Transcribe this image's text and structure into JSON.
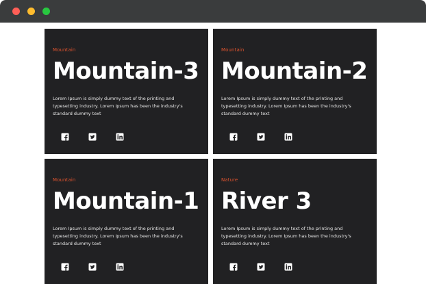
{
  "cards": [
    {
      "category": "Mountain",
      "title": "Mountain-3",
      "description": "Lorem Ipsum is simply dummy text of the printing and typesetting industry. Lorem Ipsum has been the industry's standard dummy text",
      "socials": [
        "facebook-icon",
        "twitter-icon",
        "linkedin-icon"
      ]
    },
    {
      "category": "Mountain",
      "title": "Mountain-2",
      "description": "Lorem Ipsum is simply dummy text of the printing and typesetting industry. Lorem Ipsum has been the industry's standard dummy text",
      "socials": [
        "facebook-icon",
        "twitter-icon",
        "linkedin-icon"
      ]
    },
    {
      "category": "Mountain",
      "title": "Mountain-1",
      "description": "Lorem Ipsum is simply dummy text of the printing and typesetting industry. Lorem Ipsum has been the industry's standard dummy text",
      "socials": [
        "facebook-icon",
        "twitter-icon",
        "linkedin-icon"
      ]
    },
    {
      "category": "Nature",
      "title": "River 3",
      "description": "Lorem Ipsum is simply dummy text of the printing and typesetting industry. Lorem Ipsum has been the industry's standard dummy text",
      "socials": [
        "facebook-icon",
        "twitter-icon",
        "linkedin-icon"
      ]
    }
  ],
  "colors": {
    "card_background": "#212123",
    "category_accent": "#e0542f",
    "titlebar": "#3a3c3d",
    "close": "#ff5f57",
    "minimize": "#febc2e",
    "maximize": "#28c840"
  }
}
